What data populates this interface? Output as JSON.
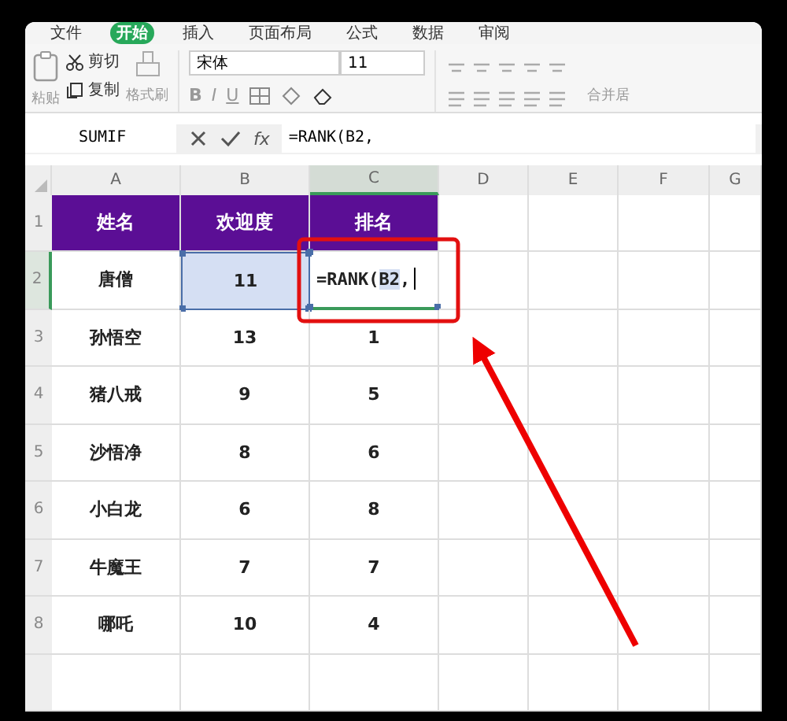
{
  "menu": {
    "tabs": [
      {
        "label": "文件",
        "selected": false
      },
      {
        "label": "开始",
        "selected": true
      },
      {
        "label": "插入",
        "selected": false
      },
      {
        "label": "页面布局",
        "selected": false
      },
      {
        "label": "公式",
        "selected": false
      },
      {
        "label": "数据",
        "selected": false
      },
      {
        "label": "审阅",
        "selected": false
      }
    ]
  },
  "ribbon": {
    "paste": "粘贴",
    "cut": "剪切",
    "copy": "复制",
    "format_painter": "格式刷",
    "font": "宋体",
    "font_size": "11",
    "style_buttons": [
      "B",
      "I",
      "U"
    ],
    "merge": "合并居"
  },
  "formula_bar": {
    "name_box": "SUMIF",
    "fx": "fx",
    "formula": "=RANK(B2,"
  },
  "grid": {
    "columns": [
      {
        "label": "A",
        "selected": false
      },
      {
        "label": "B",
        "selected": false
      },
      {
        "label": "C",
        "selected": true
      },
      {
        "label": "D",
        "selected": false
      },
      {
        "label": "E",
        "selected": false
      },
      {
        "label": "F",
        "selected": false
      },
      {
        "label": "G",
        "selected": false
      }
    ],
    "rows": [
      {
        "number": "1",
        "selected": false,
        "kind": "header",
        "cells": [
          {
            "text": "姓名",
            "referenced": false,
            "editing": false
          },
          {
            "text": "欢迎度",
            "referenced": false,
            "editing": false
          },
          {
            "text": "排名",
            "referenced": false,
            "editing": false
          }
        ]
      },
      {
        "number": "2",
        "selected": true,
        "kind": "data",
        "cells": [
          {
            "text": "唐僧",
            "referenced": false,
            "editing": false
          },
          {
            "text": "11",
            "referenced": true,
            "editing": false
          },
          {
            "text": "=RANK(",
            "reference": "B2",
            "after": ",",
            "referenced": false,
            "editing": true
          }
        ]
      },
      {
        "number": "3",
        "selected": false,
        "kind": "data",
        "cells": [
          {
            "text": "孙悟空",
            "referenced": false,
            "editing": false
          },
          {
            "text": "13",
            "referenced": false,
            "editing": false
          },
          {
            "text": "1",
            "referenced": false,
            "editing": false
          }
        ]
      },
      {
        "number": "4",
        "selected": false,
        "kind": "data",
        "cells": [
          {
            "text": "猪八戒",
            "referenced": false,
            "editing": false
          },
          {
            "text": "9",
            "referenced": false,
            "editing": false
          },
          {
            "text": "5",
            "referenced": false,
            "editing": false
          }
        ]
      },
      {
        "number": "5",
        "selected": false,
        "kind": "data",
        "cells": [
          {
            "text": "沙悟净",
            "referenced": false,
            "editing": false
          },
          {
            "text": "8",
            "referenced": false,
            "editing": false
          },
          {
            "text": "6",
            "referenced": false,
            "editing": false
          }
        ]
      },
      {
        "number": "6",
        "selected": false,
        "kind": "data",
        "cells": [
          {
            "text": "小白龙",
            "referenced": false,
            "editing": false
          },
          {
            "text": "6",
            "referenced": false,
            "editing": false
          },
          {
            "text": "8",
            "referenced": false,
            "editing": false
          }
        ]
      },
      {
        "number": "7",
        "selected": false,
        "kind": "data",
        "cells": [
          {
            "text": "牛魔王",
            "referenced": false,
            "editing": false
          },
          {
            "text": "7",
            "referenced": false,
            "editing": false
          },
          {
            "text": "7",
            "referenced": false,
            "editing": false
          }
        ]
      },
      {
        "number": "8",
        "selected": false,
        "kind": "data",
        "cells": [
          {
            "text": "哪吒",
            "referenced": false,
            "editing": false
          },
          {
            "text": "10",
            "referenced": false,
            "editing": false
          },
          {
            "text": "4",
            "referenced": false,
            "editing": false
          }
        ]
      }
    ]
  }
}
